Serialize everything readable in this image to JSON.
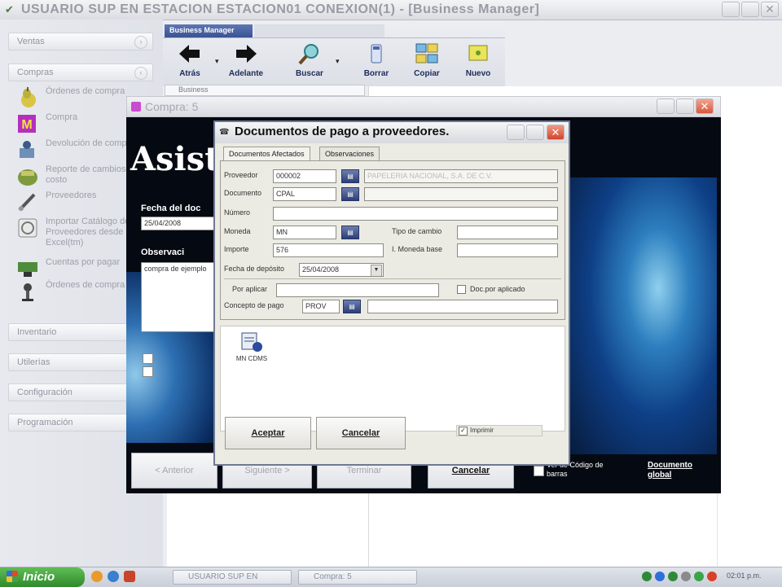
{
  "main_window": {
    "title": "USUARIO SUP EN ESTACION ESTACION01     CONEXION(1) - [Business Manager]"
  },
  "sidebar": {
    "sections": [
      {
        "label": "Ventas"
      },
      {
        "label": "Compras"
      },
      {
        "label": "Inventario"
      },
      {
        "label": "Utilerías"
      },
      {
        "label": "Configuración"
      },
      {
        "label": "Programación"
      }
    ],
    "items": [
      {
        "label": "Órdenes de compra",
        "icon": "pear-icon"
      },
      {
        "label": "Compra",
        "icon": "m-icon"
      },
      {
        "label": "Devolución de compra",
        "icon": "return-icon"
      },
      {
        "label": "Reporte de cambios de costo",
        "icon": "report-icon"
      },
      {
        "label": "Proveedores",
        "icon": "pen-icon"
      },
      {
        "label": "Importar Catálogo de Proveedores desde Excel(tm)",
        "icon": "import-icon"
      },
      {
        "label": "Cuentas por pagar",
        "icon": "money-icon"
      },
      {
        "label": "Órdenes de compra",
        "icon": "lamp-icon"
      }
    ]
  },
  "toolbar": {
    "tab_active": "Business Manager",
    "tab_inactive": "",
    "buttons": [
      {
        "label": "Atrás",
        "icon": "arrow-left-icon"
      },
      {
        "label": "Adelante",
        "icon": "arrow-right-icon"
      },
      {
        "label": "Buscar",
        "icon": "search-icon"
      },
      {
        "label": "Borrar",
        "icon": "erase-icon"
      },
      {
        "label": "Copiar",
        "icon": "copy-icon"
      },
      {
        "label": "Nuevo",
        "icon": "new-icon"
      }
    ],
    "breadcrumb": "Business"
  },
  "compra_window": {
    "title": "Compra: 5",
    "wizard_title": "Asiste",
    "fecha_label": "Fecha del doc",
    "fecha_value": "25/04/2008",
    "obs_label": "Observaci",
    "obs_value": "compra de ejemplo",
    "buttons": [
      "< Anterior",
      "Siguiente >",
      "Terminar",
      "Cancelar"
    ],
    "checkbox_label": "Ver de Código de barras",
    "documento_global_label": "Documento global"
  },
  "dialog": {
    "title": "Documentos de pago a proveedores.",
    "tabs": [
      "Documentos Afectados",
      "Observaciones"
    ],
    "fields": {
      "proveedor_label": "Proveedor",
      "proveedor_value": "000002",
      "proveedor_name": "PAPELERIA NACIONAL, S.A. DE C.V.",
      "documento_label": "Documento",
      "documento_value": "CPAL",
      "documento_name": "",
      "numero_label": "Número",
      "numero_value": "",
      "moneda_label": "Moneda",
      "moneda_value": "MN",
      "tipo_cambio_label": "Tipo de cambio",
      "tipo_cambio_value": "",
      "importe_label": "Importe",
      "importe_value": "576",
      "moneda_base_label": "I. Moneda base",
      "moneda_base_value": "",
      "fecha_deposito_label": "Fecha de depósito",
      "fecha_deposito_value": "25/04/2008",
      "por_aplicar_label": "Por aplicar",
      "por_aplicar_value": "",
      "doc_aplicado_label": "Doc.por aplicado",
      "concepto_label": "Concepto de pago",
      "concepto_value": "PROV",
      "concepto_name": ""
    },
    "file_label": "MN CDMS",
    "buttons": {
      "accept": "Aceptar",
      "cancel": "Cancelar"
    },
    "imprimir_label": "Imprimir"
  },
  "taskbar": {
    "start_label": "Inicio",
    "tasks": [
      "USUARIO SUP EN",
      "Compra: 5"
    ],
    "clock": "02:01 p.m."
  },
  "colors": {
    "dialog_border": "#6e7a93",
    "lookup_button": "#2c3e78",
    "close_red": "#e0533a",
    "start_green": "#3f9d3a"
  }
}
